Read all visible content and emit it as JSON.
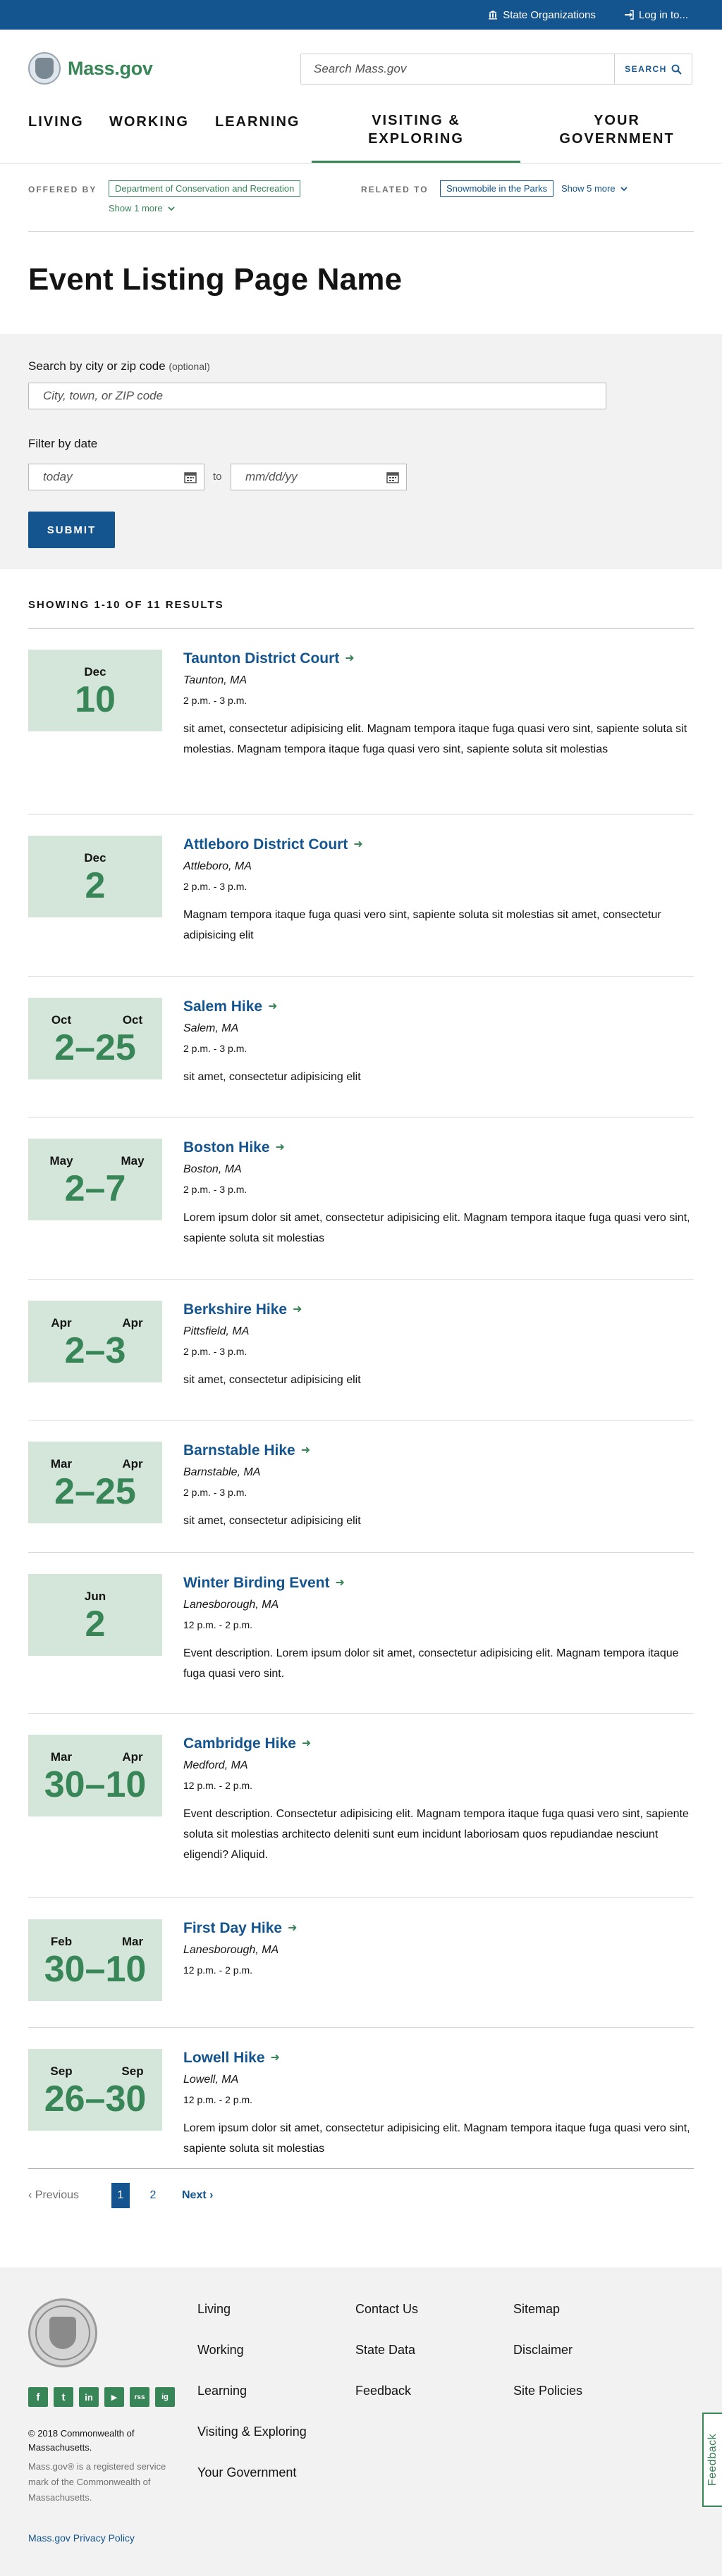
{
  "utility": {
    "state_orgs": "State Organizations",
    "login": "Log in to..."
  },
  "header": {
    "logo_text": "Mass.gov",
    "search_placeholder": "Search Mass.gov",
    "search_button": "SEARCH"
  },
  "nav": {
    "living": "LIVING",
    "working": "WORKING",
    "learning": "LEARNING",
    "visiting_1": "VISITING &",
    "visiting_2": "EXPLORING",
    "government_1": "YOUR",
    "government_2": "GOVERNMENT"
  },
  "relation": {
    "offered_label": "OFFERED BY",
    "offered_tag": "Department of Conservation and Recreation",
    "offered_more": "Show 1 more",
    "related_label": "RELATED TO",
    "related_tag": "Snowmobile in the Parks",
    "related_more": "Show 5 more"
  },
  "page_title": "Event Listing Page Name",
  "filters": {
    "city_label": "Search by city or zip code",
    "city_optional": "(optional)",
    "city_placeholder": "City, town, or ZIP code",
    "date_label": "Filter by date",
    "date_from": "today",
    "date_to_sep": "to",
    "date_to": "mm/dd/yy",
    "submit": "SUBMIT"
  },
  "results_count": "SHOWING 1-10 OF 11 RESULTS",
  "events": [
    {
      "title": "Taunton District Court",
      "location": "Taunton, MA",
      "time": "2 p.m. - 3 p.m.",
      "month1": "Dec",
      "month2": "",
      "days": "10",
      "desc": "sit amet, consectetur adipisicing elit. Magnam tempora itaque fuga quasi vero sint, sapiente soluta sit molestias. Magnam tempora itaque fuga quasi vero sint, sapiente soluta sit molestias"
    },
    {
      "title": "Attleboro District Court",
      "location": "Attleboro, MA",
      "time": "2 p.m. - 3 p.m.",
      "month1": "Dec",
      "month2": "",
      "days": "2",
      "desc": "Magnam tempora itaque fuga quasi vero sint, sapiente soluta sit molestias sit amet, consectetur adipisicing elit"
    },
    {
      "title": "Salem Hike",
      "location": "Salem, MA",
      "time": "2 p.m. - 3 p.m.",
      "month1": "Oct",
      "month2": "Oct",
      "days": "2–25",
      "desc": "sit amet, consectetur adipisicing elit"
    },
    {
      "title": "Boston Hike",
      "location": "Boston, MA",
      "time": "2 p.m. - 3 p.m.",
      "month1": "May",
      "month2": "May",
      "days": "2–7",
      "desc": "Lorem ipsum dolor sit amet, consectetur adipisicing elit. Magnam tempora itaque fuga quasi vero sint, sapiente soluta sit molestias"
    },
    {
      "title": "Berkshire Hike",
      "location": "Pittsfield, MA",
      "time": "2 p.m. - 3 p.m.",
      "month1": "Apr",
      "month2": "Apr",
      "days": "2–3",
      "desc": "sit amet, consectetur adipisicing elit"
    },
    {
      "title": "Barnstable Hike",
      "location": "Barnstable, MA",
      "time": "2 p.m. - 3 p.m.",
      "month1": "Mar",
      "month2": "Apr",
      "days": "2–25",
      "desc": "sit amet, consectetur adipisicing elit"
    },
    {
      "title": "Winter Birding Event",
      "location": "Lanesborough, MA",
      "time": "12 p.m. - 2 p.m.",
      "month1": "Jun",
      "month2": "",
      "days": "2",
      "desc": "Event description. Lorem ipsum dolor sit amet, consectetur adipisicing elit. Magnam tempora itaque fuga quasi vero sint."
    },
    {
      "title": "Cambridge Hike",
      "location": "Medford, MA",
      "time": "12 p.m. - 2 p.m.",
      "month1": "Mar",
      "month2": "Apr",
      "days": "30–10",
      "desc": "Event description. Consectetur adipisicing elit. Magnam tempora itaque fuga quasi vero sint, sapiente soluta sit molestias architecto deleniti sunt eum incidunt laboriosam quos repudiandae nesciunt eligendi? Aliquid."
    },
    {
      "title": "First Day Hike",
      "location": "Lanesborough, MA",
      "time": "12 p.m. - 2 p.m.",
      "month1": "Feb",
      "month2": "Mar",
      "days": "30–10",
      "desc": ""
    },
    {
      "title": "Lowell Hike",
      "location": "Lowell, MA",
      "time": "12 p.m. - 2 p.m.",
      "month1": "Sep",
      "month2": "Sep",
      "days": "26–30",
      "desc": "Lorem ipsum dolor sit amet, consectetur adipisicing elit. Magnam tempora itaque fuga quasi vero sint, sapiente soluta sit molestias"
    }
  ],
  "pagination": {
    "previous": "Previous",
    "page1": "1",
    "page2": "2",
    "next": "Next"
  },
  "footer": {
    "col1": [
      "Living",
      "Working",
      "Learning",
      "Visiting & Exploring",
      "Your Government"
    ],
    "col2": [
      "Contact Us",
      "State Data",
      "Feedback"
    ],
    "col3": [
      "Sitemap",
      "Disclaimer",
      "Site Policies"
    ],
    "copyright": "© 2018 Commonwealth of Massachusetts.",
    "trademark": "Mass.gov® is a registered service mark of the Commonwealth of Massachusetts.",
    "privacy": "Mass.gov Privacy Policy",
    "social": [
      "f",
      "t",
      "in",
      "▶",
      "rss",
      "ig"
    ]
  },
  "feedback_tab": "Feedback",
  "colors": {
    "brand_blue": "#14558f",
    "brand_green": "#388557",
    "date_bg": "#d4e6da"
  }
}
